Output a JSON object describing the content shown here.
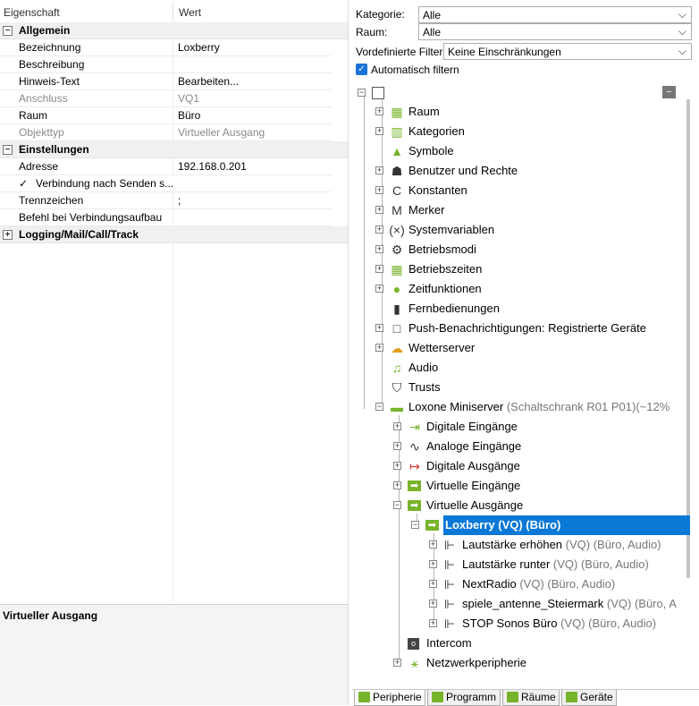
{
  "properties": {
    "header": {
      "name_col": "Eigenschaft",
      "value_col": "Wert"
    },
    "groups": [
      {
        "label": "Allgemein",
        "toggle": "−"
      },
      {
        "label": "Einstellungen",
        "toggle": "−"
      },
      {
        "label": "Logging/Mail/Call/Track",
        "toggle": "+"
      }
    ],
    "rows": [
      {
        "name": "Bezeichnung",
        "value": "Loxberry"
      },
      {
        "name": "Beschreibung",
        "value": ""
      },
      {
        "name": "Hinweis-Text",
        "value": "Bearbeiten..."
      },
      {
        "name": "Anschluss",
        "value": "VQ1"
      },
      {
        "name": "Raum",
        "value": "Büro"
      },
      {
        "name": "Objekttyp",
        "value": "Virtueller Ausgang"
      },
      {
        "name": "Adresse",
        "value": "192.168.0.201"
      },
      {
        "name": "Verbindung nach Senden s...",
        "value": "",
        "checked": "✓"
      },
      {
        "name": "Trennzeichen",
        "value": ";"
      },
      {
        "name": "Befehl bei Verbindungsaufbau",
        "value": ""
      }
    ],
    "description_title": "Virtueller Ausgang"
  },
  "filters": {
    "category_label": "Kategorie:",
    "category_value": "Alle",
    "room_label": "Raum:",
    "room_value": "Alle",
    "predefined_label": "Vordefinierte Filter",
    "predefined_value": "Keine Einschränkungen",
    "auto_filter_label": "Automatisch filtern",
    "caret": "⌵"
  },
  "tree": {
    "root_toggle": "−",
    "collapse_all": "−",
    "items": [
      {
        "label": "Raum",
        "meta": "",
        "icon": "room-icon"
      },
      {
        "label": "Kategorien",
        "meta": "",
        "icon": "categories-icon"
      },
      {
        "label": "Symbole",
        "meta": "",
        "icon": "symbols-icon"
      },
      {
        "label": "Benutzer und Rechte",
        "meta": "",
        "icon": "users-icon"
      },
      {
        "label": "Konstanten",
        "meta": "",
        "icon": "constants-icon",
        "glyph": "C"
      },
      {
        "label": "Merker",
        "meta": "",
        "icon": "flags-icon",
        "glyph": "M"
      },
      {
        "label": "Systemvariablen",
        "meta": "",
        "icon": "system-variables-icon",
        "glyph": "(×)"
      },
      {
        "label": "Betriebsmodi",
        "meta": "",
        "icon": "operating-modes-icon"
      },
      {
        "label": "Betriebszeiten",
        "meta": "",
        "icon": "operating-times-icon"
      },
      {
        "label": "Zeitfunktionen",
        "meta": "",
        "icon": "time-functions-icon"
      },
      {
        "label": "Fernbedienungen",
        "meta": "",
        "icon": "remote-controls-icon"
      },
      {
        "label": "Push-Benachrichtigungen: Registrierte Geräte",
        "meta": "",
        "icon": "push-notifications-icon"
      },
      {
        "label": "Wetterserver",
        "meta": "",
        "icon": "weather-server-icon"
      },
      {
        "label": "Audio",
        "meta": "",
        "icon": "audio-icon"
      },
      {
        "label": "Trusts",
        "meta": "",
        "icon": "trusts-icon"
      },
      {
        "label": "Loxone Miniserver",
        "meta": " (Schaltschrank R01 P01)(~12%",
        "icon": "miniserver-icon"
      },
      {
        "label": "Digitale Eingänge",
        "meta": "",
        "icon": "digital-inputs-icon"
      },
      {
        "label": "Analoge Eingänge",
        "meta": "",
        "icon": "analog-inputs-icon"
      },
      {
        "label": "Digitale Ausgänge",
        "meta": "",
        "icon": "digital-outputs-icon"
      },
      {
        "label": "Virtuelle Eingänge",
        "meta": "",
        "icon": "virtual-inputs-icon"
      },
      {
        "label": "Virtuelle Ausgänge",
        "meta": "",
        "icon": "virtual-outputs-icon"
      },
      {
        "label": "Loxberry (VQ) (Büro)",
        "meta": "",
        "icon": "virtual-output-icon"
      },
      {
        "label": "Lautstärke erhöhen",
        "meta": " (VQ) (Büro, Audio)",
        "icon": "virtual-output-command-icon"
      },
      {
        "label": "Lautstärke runter",
        "meta": " (VQ) (Büro, Audio)",
        "icon": "virtual-output-command-icon"
      },
      {
        "label": "NextRadio",
        "meta": " (VQ) (Büro, Audio)",
        "icon": "virtual-output-command-icon"
      },
      {
        "label": "spiele_antenne_Steiermark",
        "meta": " (VQ) (Büro, A",
        "icon": "virtual-output-command-icon"
      },
      {
        "label": "STOP Sonos Büro",
        "meta": " (VQ) (Büro, Audio)",
        "icon": "virtual-output-command-icon"
      },
      {
        "label": "Intercom",
        "meta": "",
        "icon": "intercom-icon"
      },
      {
        "label": "Netzwerkperipherie",
        "meta": "",
        "icon": "network-peripherals-icon"
      }
    ]
  },
  "tabs": [
    {
      "label": "Peripherie"
    },
    {
      "label": "Programm"
    },
    {
      "label": "Räume"
    },
    {
      "label": "Geräte"
    }
  ],
  "colors": {
    "accent_green": "#78b42b",
    "selection_blue": "#0a78d7",
    "checkbox_blue": "#1a73d9"
  }
}
